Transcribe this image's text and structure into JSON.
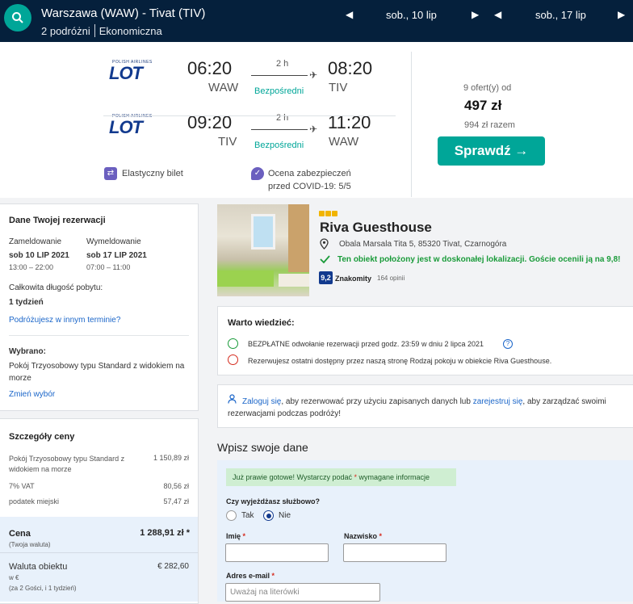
{
  "header": {
    "route": "Warszawa (WAW) - Tivat (TIV)",
    "passengers": "2 podróżni",
    "cabin": "Ekonomiczna",
    "depart_date": "sob., 10 lip",
    "return_date": "sob., 17 lip"
  },
  "flights": {
    "outbound": {
      "airline": "LOT",
      "airline_small": "POLISH AIRLINES",
      "dep_time": "06:20",
      "dep_code": "WAW",
      "duration": "2 h",
      "stops": "Bezpośredni",
      "arr_time": "08:20",
      "arr_code": "TIV"
    },
    "inbound": {
      "airline": "LOT",
      "airline_small": "POLISH AIRLINES",
      "dep_time": "09:20",
      "dep_code": "TIV",
      "duration": "2 h",
      "stops": "Bezpośredni",
      "arr_time": "11:20",
      "arr_code": "WAW"
    },
    "flex_ticket": "Elastyczny bilet",
    "covid_line1": "Ocena zabezpieczeń",
    "covid_line2": "przed COVID-19: 5/5",
    "offers": "9 ofert(y) od",
    "price": "497 zł",
    "total": "994 zł razem",
    "check_button": "Sprawdź →"
  },
  "reservation": {
    "title": "Dane Twojej rezerwacji",
    "checkin_label": "Zameldowanie",
    "checkin_date": "sob 10 LIP 2021",
    "checkin_time": "13:00 – 22:00",
    "checkout_label": "Wymeldowanie",
    "checkout_date": "sob 17 LIP 2021",
    "checkout_time": "07:00 – 11:00",
    "stay_label": "Całkowita długość pobytu:",
    "stay_value": "1 tydzień",
    "other_dates_link": "Podróżujesz w innym terminie?",
    "selected_label": "Wybrano:",
    "selected_value": "Pokój Trzyosobowy typu Standard z widokiem na morze",
    "change_link": "Zmień wybór"
  },
  "price_details": {
    "title": "Szczegóły ceny",
    "rows": [
      {
        "label": "Pokój Trzyosobowy typu Standard z widokiem na morze",
        "value": "1 150,89 zł"
      },
      {
        "label": "7% VAT",
        "value": "80,56 zł"
      },
      {
        "label": "podatek miejski",
        "value": "57,47 zł"
      }
    ],
    "price_label": "Cena",
    "price_value": "1 288,91 zł *",
    "price_sub": "(Twoja waluta)",
    "currency_label": "Waluta obiektu",
    "currency_value": "€ 282,60",
    "currency_sub": "w €",
    "guests_sub": "(za 2 Gości, i 1 tydzień)"
  },
  "hotel": {
    "name": "Riva Guesthouse",
    "address": "Obala Marsala Tita 5, 85320 Tivat, Czarnogóra",
    "location_note": "Ten obiekt położony jest w doskonałej lokalizacji. Goście ocenili ją na 9,8!",
    "score": "9,2",
    "score_word": "Znakomity",
    "reviews": "164 opinii"
  },
  "good_to_know": {
    "title": "Warto wiedzieć:",
    "items": [
      "BEZPŁATNE odwołanie rezerwacji przed godz. 23:59 w dniu 2 lipca 2021",
      "Rezerwujesz ostatni dostępny przez naszą stronę Rodzaj pokoju w obiekcie Riva Guesthouse."
    ]
  },
  "login": {
    "link1": "Zaloguj się",
    "text1": ", aby rezerwować przy użyciu zapisanych danych lub ",
    "link2": "zarejestruj się",
    "text2": ", aby zarządzać swoimi rezerwacjami podczas podróży!"
  },
  "form": {
    "title": "Wpisz swoje dane",
    "ready_text": "Już prawie gotowe! Wystarczy podać ",
    "ready_star": "*",
    "ready_text2": " wymagane informacje",
    "business_q": "Czy wyjeżdżasz służbowo?",
    "yes": "Tak",
    "no": "Nie",
    "first_name": "Imię",
    "last_name": "Nazwisko",
    "email": "Adres e-mail",
    "email_placeholder": "Uważaj na literówki",
    "req": "*"
  },
  "colors": {
    "navy": "#05203c",
    "teal": "#00a698",
    "link": "#1b66c9",
    "green": "#1a9b3a"
  }
}
